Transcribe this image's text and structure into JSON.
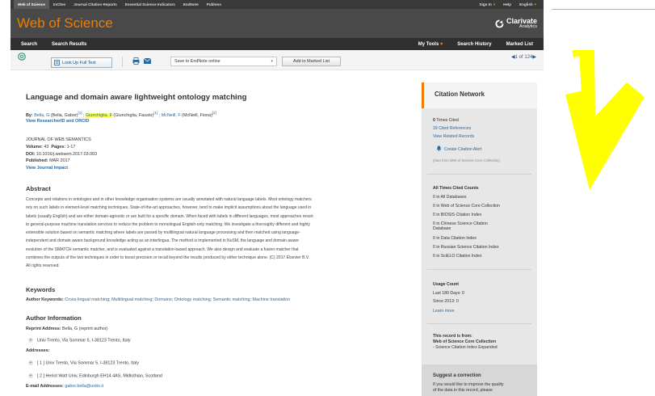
{
  "top_nav": {
    "items": [
      {
        "label": "Web of Science",
        "active": true
      },
      {
        "label": "InCites"
      },
      {
        "label": "Journal Citation Reports"
      },
      {
        "label": "Essential Science Indicators"
      },
      {
        "label": "EndNote"
      },
      {
        "label": "Publons"
      }
    ],
    "sign_in": "Sign In",
    "help": "Help",
    "language": "English"
  },
  "brand": {
    "title": "Web of Science",
    "clarivate_name": "Clarivate",
    "clarivate_sub": "Analytics"
  },
  "sub_nav": {
    "search": "Search",
    "search_results": "Search Results",
    "my_tools": "My Tools",
    "search_history": "Search History",
    "marked_list": "Marked List"
  },
  "toolbar": {
    "full_text_label": "Look Up Full Text",
    "save_select_value": "Save to EndNote online",
    "add_marked_label": "Add to Marked List",
    "pager_current": "1",
    "pager_of": "of",
    "pager_total": "124"
  },
  "record": {
    "title": "Language and domain aware lightweight ontology matching",
    "by_label": "By:",
    "authors": [
      {
        "short": "Bella, G",
        "full": "(Bella, Gabor)",
        "ref": "[1]",
        "sep": " ; "
      },
      {
        "short": "Giunchiglia, F",
        "full": "(Giunchiglia, Fausto)",
        "ref": "[1]",
        "sep": " ; "
      },
      {
        "short": "McNeill, F",
        "full": "(McNeill, Fiona)",
        "ref": "[2]",
        "sep": ""
      }
    ],
    "researcher_link": "View ResearcherID and ORCID",
    "journal": "JOURNAL OF WEB SEMANTICS",
    "volume_label": "Volume:",
    "volume": "43",
    "pages_label": "Pages:",
    "pages": "1-17",
    "doi_label": "DOI:",
    "doi": "10.1016/j.websem.2017.03.003",
    "published_label": "Published:",
    "published": "MAR 2017",
    "journal_impact": "View Journal Impact",
    "abstract_heading": "Abstract",
    "abstract_lines": [
      "Concepts and relations in ontologies and in other knowledge organisation systems are usually annotated with natural language labels. Most ontology matchers",
      "rely on such labels in element-level matching techniques. State-of-the-art approaches, however, tend to make implicit assumptions about the language used in",
      "labels (usually English) and are either domain-agnostic or are built for a specific domain. When faced with labels in different languages, most approaches resort",
      "to general-purpose machine translation services to reduce the problem to monolingual English-only matching. We investigate a thoroughly different and highly",
      "extensible solution based on semantic matching where labels are parsed by multilingual natural language processing and then matched using language-",
      "independent and domain aware background knowledge acting as an interlingua. The method is implemented in NuSM, the language and domain aware",
      "evolution of the SMATCH semantic matcher, and is evaluated against a translation-based approach. We also design and evaluate a fusion matcher that",
      "combines the outputs of the two techniques in order to boost precision or recall beyond the results produced by either technique alone. (C) 2017 Elsevier B.V.",
      "All rights reserved."
    ],
    "keywords_heading": "Keywords",
    "author_keywords_label": "Author Keywords:",
    "author_keywords": [
      "Cross-lingual matching",
      "Multilingual matching",
      "Domains",
      "Ontology matching",
      "Semantic matching",
      "Machine translation"
    ],
    "author_info_heading": "Author Information",
    "reprint_label": "Reprint Address:",
    "reprint_value": "Bella, G (reprint author)",
    "reprint_addr": "Univ Trento, Via Sommar 5, I-38123 Trento, Italy",
    "addresses_label": "Addresses:",
    "addresses": [
      "[ 1 ] Univ Trento, Via Sommar 5, I-38123 Trento, Italy",
      "[ 2 ] Heriot Watt Univ, Edinburgh EH14 4AS, Midlothian, Scotland"
    ],
    "email_label": "E-mail Addresses:",
    "email": "gabor.bella@unitn.it"
  },
  "sidebar": {
    "citation_network": "Citation Network",
    "times_cited_count": "0",
    "times_cited_label": "Times Cited",
    "cited_references": "39 Cited References",
    "related_records": "View Related Records",
    "create_alert": "Create Citation Alert",
    "data_note": "(data from Web of Science Core Collection)",
    "all_times_heading": "All Times Cited Counts",
    "counts": [
      "0 in All Databases",
      "0 in Web of Science Core Collection",
      "0 in BIOSIS Citation Index",
      "0 in Chinese Science Citation",
      "Database",
      "0 in Data Citation Index",
      "0 in Russian Science Citation Index",
      "0 in SciELO Citation Index"
    ],
    "usage_heading": "Usage Count",
    "last_180": "Last 180 Days: 0",
    "since_2013": "Since 2013: 0",
    "learn_more": "Learn more",
    "record_from": "This record is from:",
    "record_collection": "Web of Science Core Collection",
    "record_index": "- Science Citation Index Expanded",
    "suggest_heading": "Suggest a correction",
    "suggest_line1": "If you would like to improve the quality",
    "suggest_line2": "of the data in this record, please"
  },
  "colors": {
    "brand_orange": "#f07d00",
    "link_blue": "#2a6aa0",
    "highlight_yellow": "#ffff55",
    "arrow_yellow": "#ffff00"
  }
}
